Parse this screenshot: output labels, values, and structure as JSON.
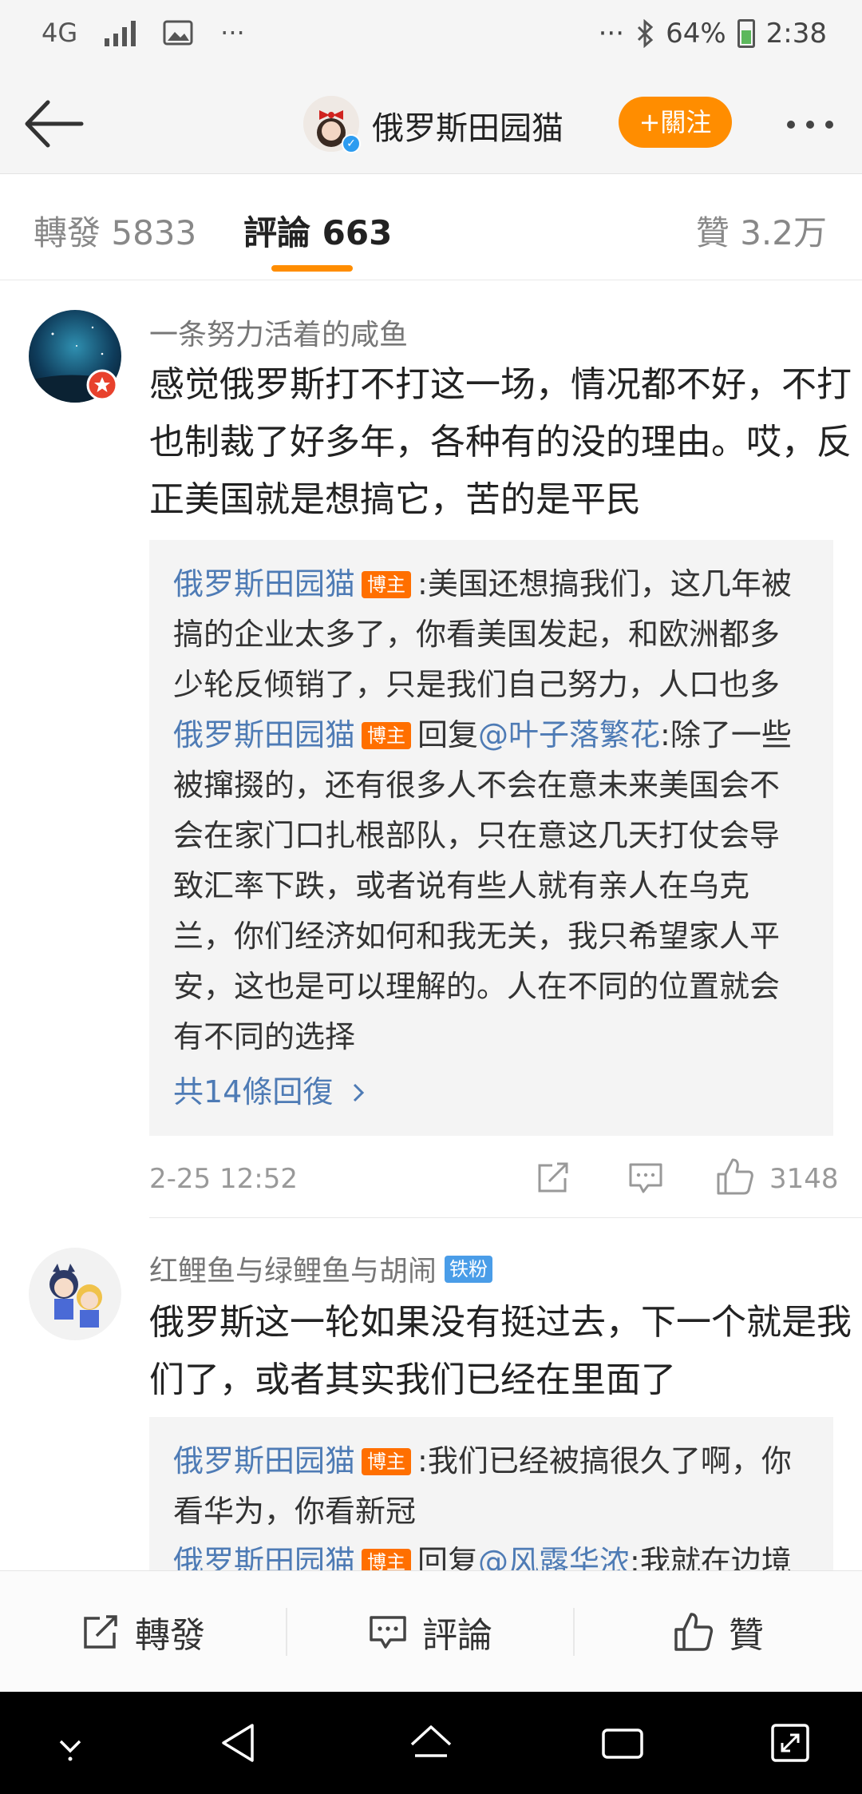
{
  "status_bar": {
    "network": "4G",
    "overflow": "···",
    "overflow_right": "···",
    "battery": "64%",
    "time": "2:38"
  },
  "header": {
    "title": "俄罗斯田园猫",
    "follow_label": "+關注",
    "icons": [
      "back-arrow-icon",
      "more-icon",
      "verified-icon"
    ]
  },
  "tabs": {
    "repost": "轉發 5833",
    "comments": "評論 663",
    "likes": "贊 3.2万"
  },
  "comments": [
    {
      "user": "一条努力活着的咸鱼",
      "text": "感觉俄罗斯打不打这一场，情况都不好，不打也制裁了好多年，各种有的没的理由。哎，反正美国就是想搞它，苦的是平民",
      "replies": [
        {
          "user": "俄罗斯田园猫",
          "badge": "博主",
          "reply_word": "",
          "at": "",
          "text": ":美国还想搞我们，这几年被搞的企业太多了，你看美国发起，和欧洲都多少轮反倾销了，只是我们自己努力，人口也多"
        },
        {
          "user": "俄罗斯田园猫",
          "badge": "博主",
          "reply_word": "回复",
          "at": "@叶子落繁花",
          "text": ":除了一些被撺掇的，还有很多人不会在意未来美国会不会在家门口扎根部队，只在意这几天打仗会导致汇率下跌，或者说有些人就有亲人在乌克兰，你们经济如何和我无关，我只希望家人平安，这也是可以理解的。人在不同的位置就会有不同的选择"
        }
      ],
      "more_replies": "共14條回復",
      "time": "2-25 12:52",
      "likes": "3148"
    },
    {
      "user": "红鲤鱼与绿鲤鱼与胡闹",
      "fan_badge": "铁粉",
      "text": "俄罗斯这一轮如果没有挺过去，下一个就是我们了，或者其实我们已经在里面了",
      "replies": [
        {
          "user": "俄罗斯田园猫",
          "badge": "博主",
          "reply_word": "",
          "at": "",
          "text": ":我们已经被搞很久了啊，你看华为，你看新冠"
        },
        {
          "user": "俄罗斯田园猫",
          "badge": "博主",
          "reply_word": "回复",
          "at": "@风露华浓",
          "text": ":我就在边境"
        }
      ]
    }
  ],
  "action_bar": {
    "repost": "轉發",
    "comment": "評論",
    "like": "贊"
  },
  "colors": {
    "accent": "#ff8d00",
    "link": "#4e7bb5",
    "host_badge": "#ff6f00",
    "fan_badge": "#4a9de8"
  }
}
